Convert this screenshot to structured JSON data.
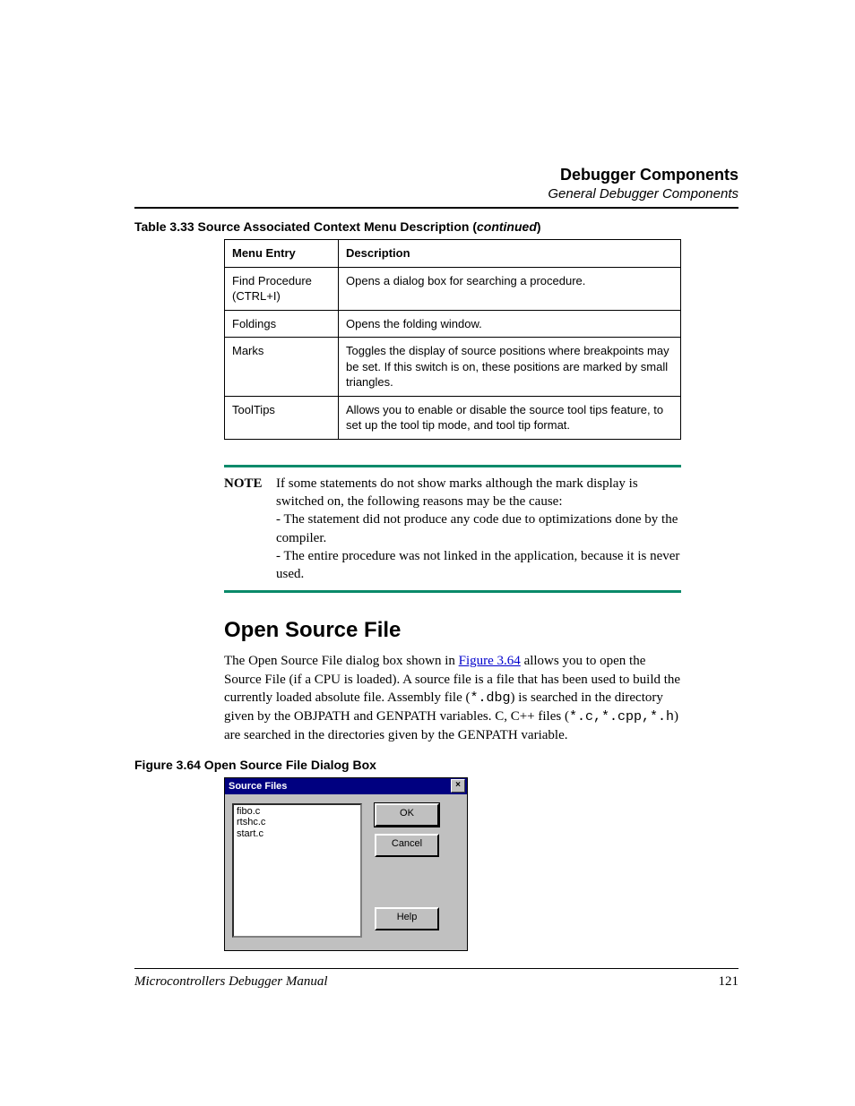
{
  "header": {
    "title": "Debugger Components",
    "subtitle": "General Debugger Components"
  },
  "table": {
    "caption_prefix": "Table 3.33  Source Associated Context Menu Description (",
    "caption_suffix": "continued",
    "caption_close": ")",
    "col1": "Menu Entry",
    "col2": "Description",
    "rows": [
      {
        "entry": "Find Procedure (CTRL+I)",
        "desc": "Opens a dialog box for searching a procedure."
      },
      {
        "entry": "Foldings",
        "desc": "Opens the folding window."
      },
      {
        "entry": "Marks",
        "desc": "Toggles the display of source positions where breakpoints may be set. If this switch is on, these positions are marked by small triangles."
      },
      {
        "entry": "ToolTips",
        "desc": "Allows you to enable or disable the source tool tips feature, to set up the tool tip mode, and tool tip format."
      }
    ]
  },
  "note": {
    "label": "NOTE",
    "l1": "If some statements do not show marks although the mark display is switched on, the following reasons may be the cause:",
    "l2": "- The statement did not produce any code due to optimizations done by the compiler.",
    "l3": "- The entire procedure was not linked in the application, because it is never used."
  },
  "section": {
    "heading": "Open Source File",
    "para_a": "The Open Source File dialog box shown in ",
    "para_link": "Figure 3.64",
    "para_b": " allows you to open the Source File (if a CPU is loaded). A source file is a file that has been used to build the currently loaded absolute file. Assembly file (",
    "code1": "*.dbg",
    "para_c": ") is searched in the directory given by the OBJPATH and GENPATH variables. C, C++ files (",
    "code2": "*.c,*.cpp,*.h",
    "para_d": ") are searched in the directories given by the GENPATH variable."
  },
  "figure": {
    "caption": "Figure 3.64  Open Source File Dialog Box",
    "title": "Source Files",
    "close": "×",
    "files": [
      "fibo.c",
      "rtshc.c",
      "start.c"
    ],
    "ok": "OK",
    "cancel": "Cancel",
    "help": "Help"
  },
  "footer": {
    "title": "Microcontrollers Debugger Manual",
    "page": "121"
  }
}
